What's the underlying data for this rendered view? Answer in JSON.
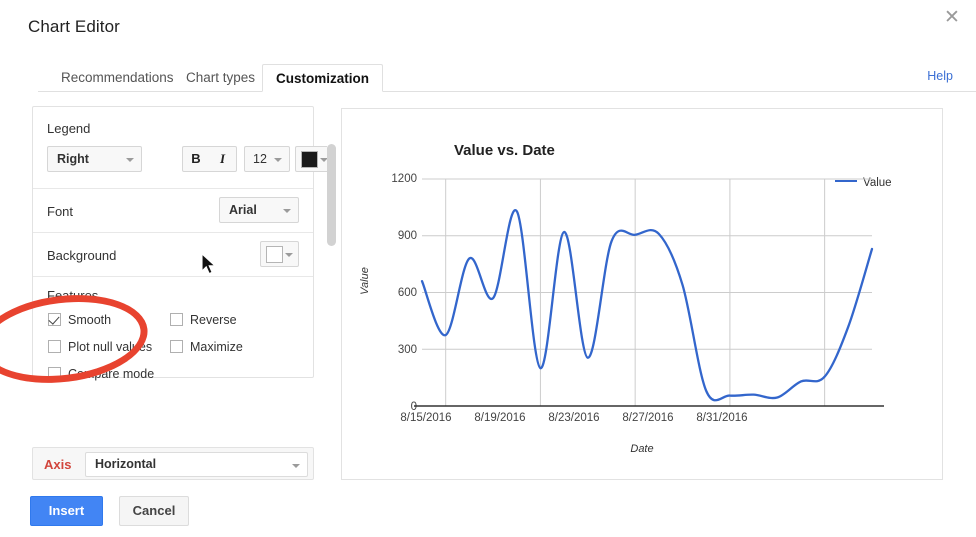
{
  "dialog": {
    "title": "Chart Editor",
    "close_icon": "close-icon",
    "help_label": "Help"
  },
  "tabs": [
    {
      "label": "Recommendations",
      "active": false
    },
    {
      "label": "Chart types",
      "active": false
    },
    {
      "label": "Customization",
      "active": true
    }
  ],
  "settings": {
    "legend": {
      "section_label": "Legend",
      "position_value": "Right",
      "bold_label": "B",
      "italic_label": "I",
      "size_value": "12",
      "color_value": "#1a1a1a"
    },
    "font": {
      "section_label": "Font",
      "value": "Arial"
    },
    "background": {
      "section_label": "Background",
      "color_value": "#ffffff"
    },
    "features": {
      "section_label": "Features",
      "items": [
        {
          "label": "Smooth",
          "checked": true
        },
        {
          "label": "Reverse",
          "checked": false
        },
        {
          "label": "Plot null values",
          "checked": false
        },
        {
          "label": "Maximize",
          "checked": false
        },
        {
          "label": "Compare mode",
          "checked": false
        }
      ]
    },
    "axis": {
      "label": "Axis",
      "value": "Horizontal",
      "label_color": "#d2453c"
    }
  },
  "footer": {
    "insert_label": "Insert",
    "cancel_label": "Cancel",
    "insert_color": "#4285f4"
  },
  "chart_data": {
    "type": "line",
    "title": "Value vs. Date",
    "xlabel": "Date",
    "ylabel": "Value",
    "ylim": [
      0,
      1200
    ],
    "yticks": [
      0,
      300,
      600,
      900,
      1200
    ],
    "xticks": [
      "8/15/2016",
      "8/19/2016",
      "8/23/2016",
      "8/27/2016",
      "8/31/2016"
    ],
    "grid": true,
    "legend_position": "right",
    "smooth": true,
    "series": [
      {
        "name": "Value",
        "color": "#3366cc",
        "x": [
          "8/14/2016",
          "8/15/2016",
          "8/16/2016",
          "8/17/2016",
          "8/18/2016",
          "8/19/2016",
          "8/20/2016",
          "8/21/2016",
          "8/22/2016",
          "8/23/2016",
          "8/24/2016",
          "8/25/2016",
          "8/26/2016",
          "8/27/2016",
          "8/28/2016",
          "8/29/2016",
          "8/30/2016",
          "8/31/2016",
          "9/1/2016",
          "9/2/2016"
        ],
        "values": [
          660,
          375,
          780,
          570,
          1030,
          200,
          920,
          255,
          870,
          905,
          910,
          640,
          80,
          55,
          60,
          45,
          130,
          155,
          420,
          830
        ]
      }
    ]
  }
}
